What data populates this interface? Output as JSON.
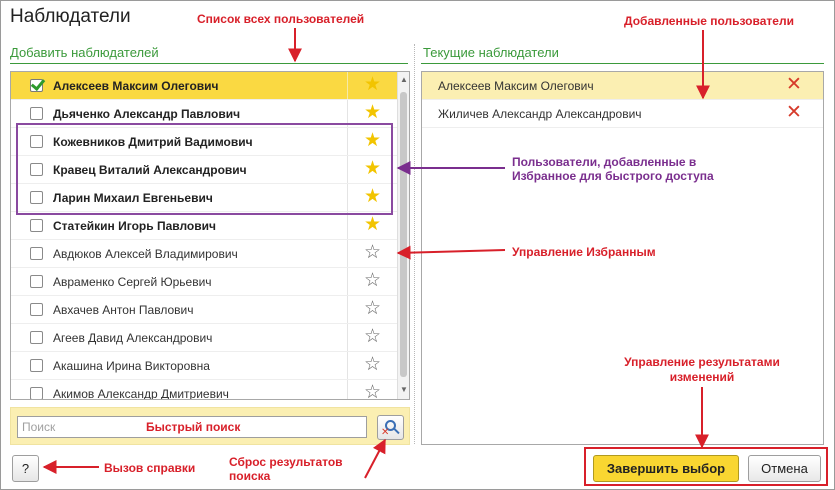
{
  "window": {
    "title": "Наблюдатели"
  },
  "left_panel": {
    "title": "Добавить наблюдателей",
    "users": [
      {
        "name": "Алексеев Максим Олегович",
        "checked": true,
        "favorite": true,
        "selected": true
      },
      {
        "name": "Дьяченко Александр Павлович",
        "checked": false,
        "favorite": true,
        "selected": false
      },
      {
        "name": "Кожевников Дмитрий Вадимович",
        "checked": false,
        "favorite": true,
        "selected": false
      },
      {
        "name": "Кравец Виталий Александрович",
        "checked": false,
        "favorite": true,
        "selected": false
      },
      {
        "name": "Ларин Михаил Евгеньевич",
        "checked": false,
        "favorite": true,
        "selected": false
      },
      {
        "name": "Статейкин Игорь Павлович",
        "checked": false,
        "favorite": true,
        "selected": false
      },
      {
        "name": "Авдюков Алексей Владимирович",
        "checked": false,
        "favorite": false,
        "selected": false
      },
      {
        "name": "Авраменко Сергей Юрьевич",
        "checked": false,
        "favorite": false,
        "selected": false
      },
      {
        "name": "Авхачев Антон Павлович",
        "checked": false,
        "favorite": false,
        "selected": false
      },
      {
        "name": "Агеев Давид Александрович",
        "checked": false,
        "favorite": false,
        "selected": false
      },
      {
        "name": "Акашина Ирина Викторовна",
        "checked": false,
        "favorite": false,
        "selected": false
      },
      {
        "name": "Акимов Александр Дмитриевич",
        "checked": false,
        "favorite": false,
        "selected": false
      }
    ],
    "icons": {
      "favorite": "star-filled-icon",
      "not_favorite": "star-outline-icon",
      "check": "checkmark-icon"
    }
  },
  "right_panel": {
    "title": "Текущие наблюдатели",
    "users": [
      {
        "name": "Алексеев Максим Олегович",
        "selected": true
      },
      {
        "name": "Жиличев Александр Александрович",
        "selected": false
      }
    ],
    "icons": {
      "remove": "delete-x-icon"
    }
  },
  "search": {
    "placeholder": "Поиск",
    "clear_icon": "search-reset-icon"
  },
  "buttons": {
    "help": "?",
    "finish": "Завершить выбор",
    "cancel": "Отмена"
  },
  "annotations": {
    "all_users": "Список всех пользователей",
    "added_users": "Добавленные пользователи",
    "favorites_line1": "Пользователи, добавленные в",
    "favorites_line2": "Избранное для быстрого доступа",
    "manage_favorites": "Управление Избранным",
    "quick_search": "Быстрый поиск",
    "results_line1": "Управление результатами",
    "results_line2": "изменений",
    "help_call": "Вызов справки",
    "reset_line1": "Сброс результатов",
    "reset_line2": "поиска"
  },
  "colors": {
    "accent_green": "#3b9a3b",
    "selection": "#fad942",
    "annotation_red": "#d8202a",
    "annotation_purple": "#7a2e8e",
    "star": "#f2c400"
  }
}
